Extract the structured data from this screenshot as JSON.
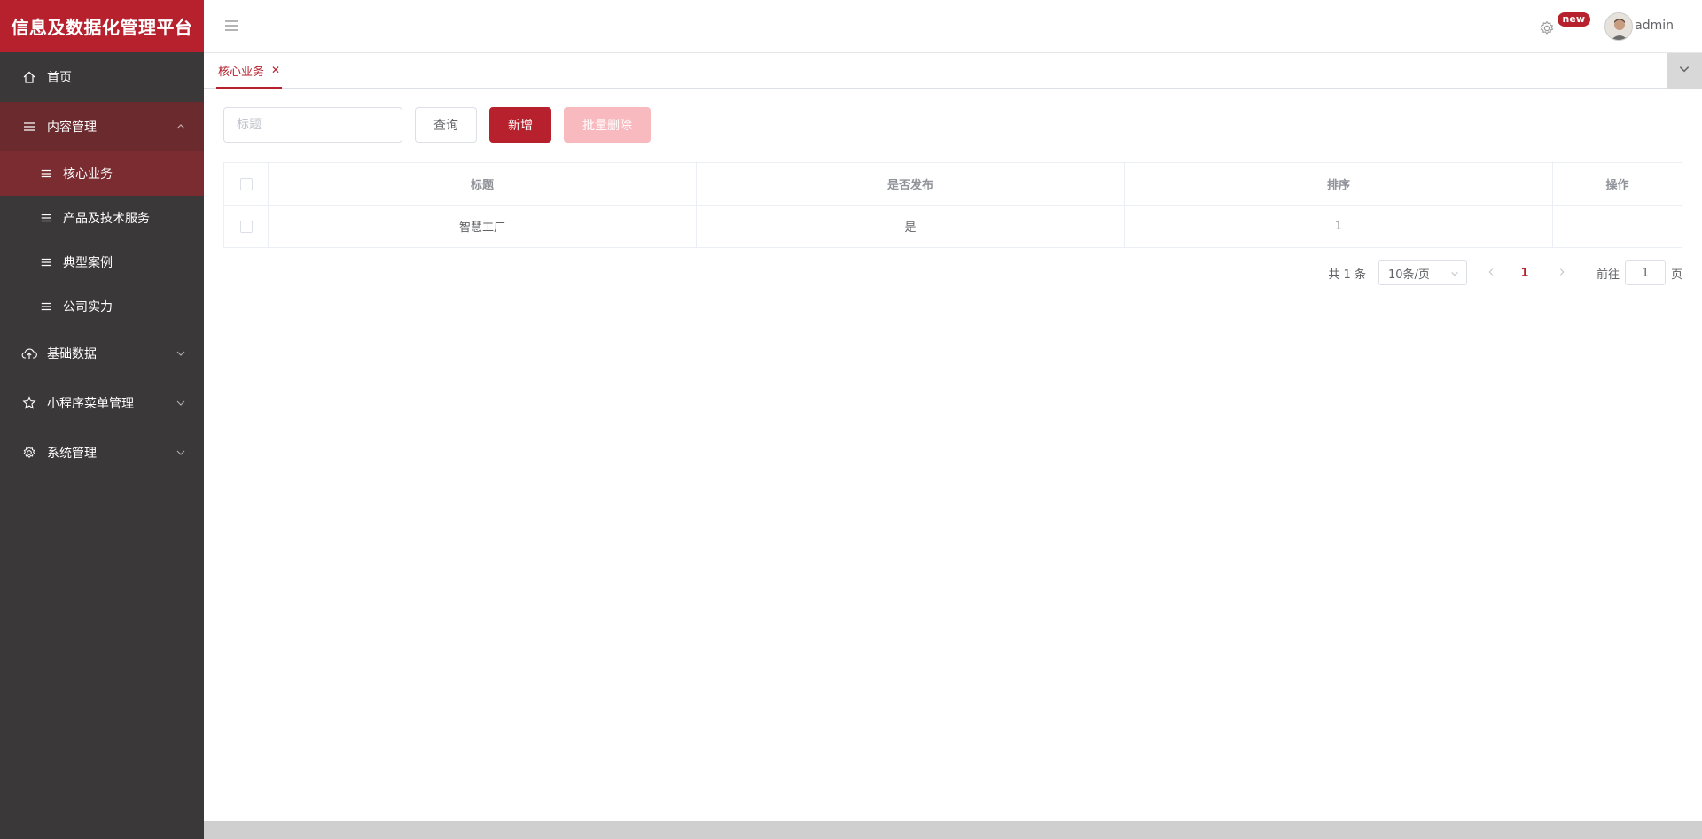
{
  "brand": "信息及数据化管理平台",
  "sidebar": {
    "items": [
      {
        "label": "首页",
        "icon": "home-icon"
      },
      {
        "label": "内容管理",
        "icon": "menu-icon",
        "open": true,
        "children": [
          {
            "label": "核心业务",
            "active": true
          },
          {
            "label": "产品及技术服务"
          },
          {
            "label": "典型案例"
          },
          {
            "label": "公司实力"
          }
        ]
      },
      {
        "label": "基础数据",
        "icon": "cloud-upload-icon"
      },
      {
        "label": "小程序菜单管理",
        "icon": "star-icon"
      },
      {
        "label": "系统管理",
        "icon": "gear-icon"
      }
    ]
  },
  "header": {
    "badge": "new",
    "username": "admin"
  },
  "tabs": [
    {
      "label": "核心业务"
    }
  ],
  "toolbar": {
    "search_placeholder": "标题",
    "query_label": "查询",
    "add_label": "新增",
    "batch_delete_label": "批量删除"
  },
  "table": {
    "columns": [
      "标题",
      "是否发布",
      "排序",
      "操作"
    ],
    "rows": [
      {
        "title": "智慧工厂",
        "published": "是",
        "order": "1",
        "actions": ""
      }
    ]
  },
  "pagination": {
    "total_text": "共 1 条",
    "page_size": "10条/页",
    "current_page": "1",
    "goto_prefix": "前往",
    "goto_value": "1",
    "goto_suffix": "页"
  },
  "colors": {
    "brand": "#b7202d",
    "sidebar": "#3a3838",
    "active_item": "#7b2c31"
  }
}
